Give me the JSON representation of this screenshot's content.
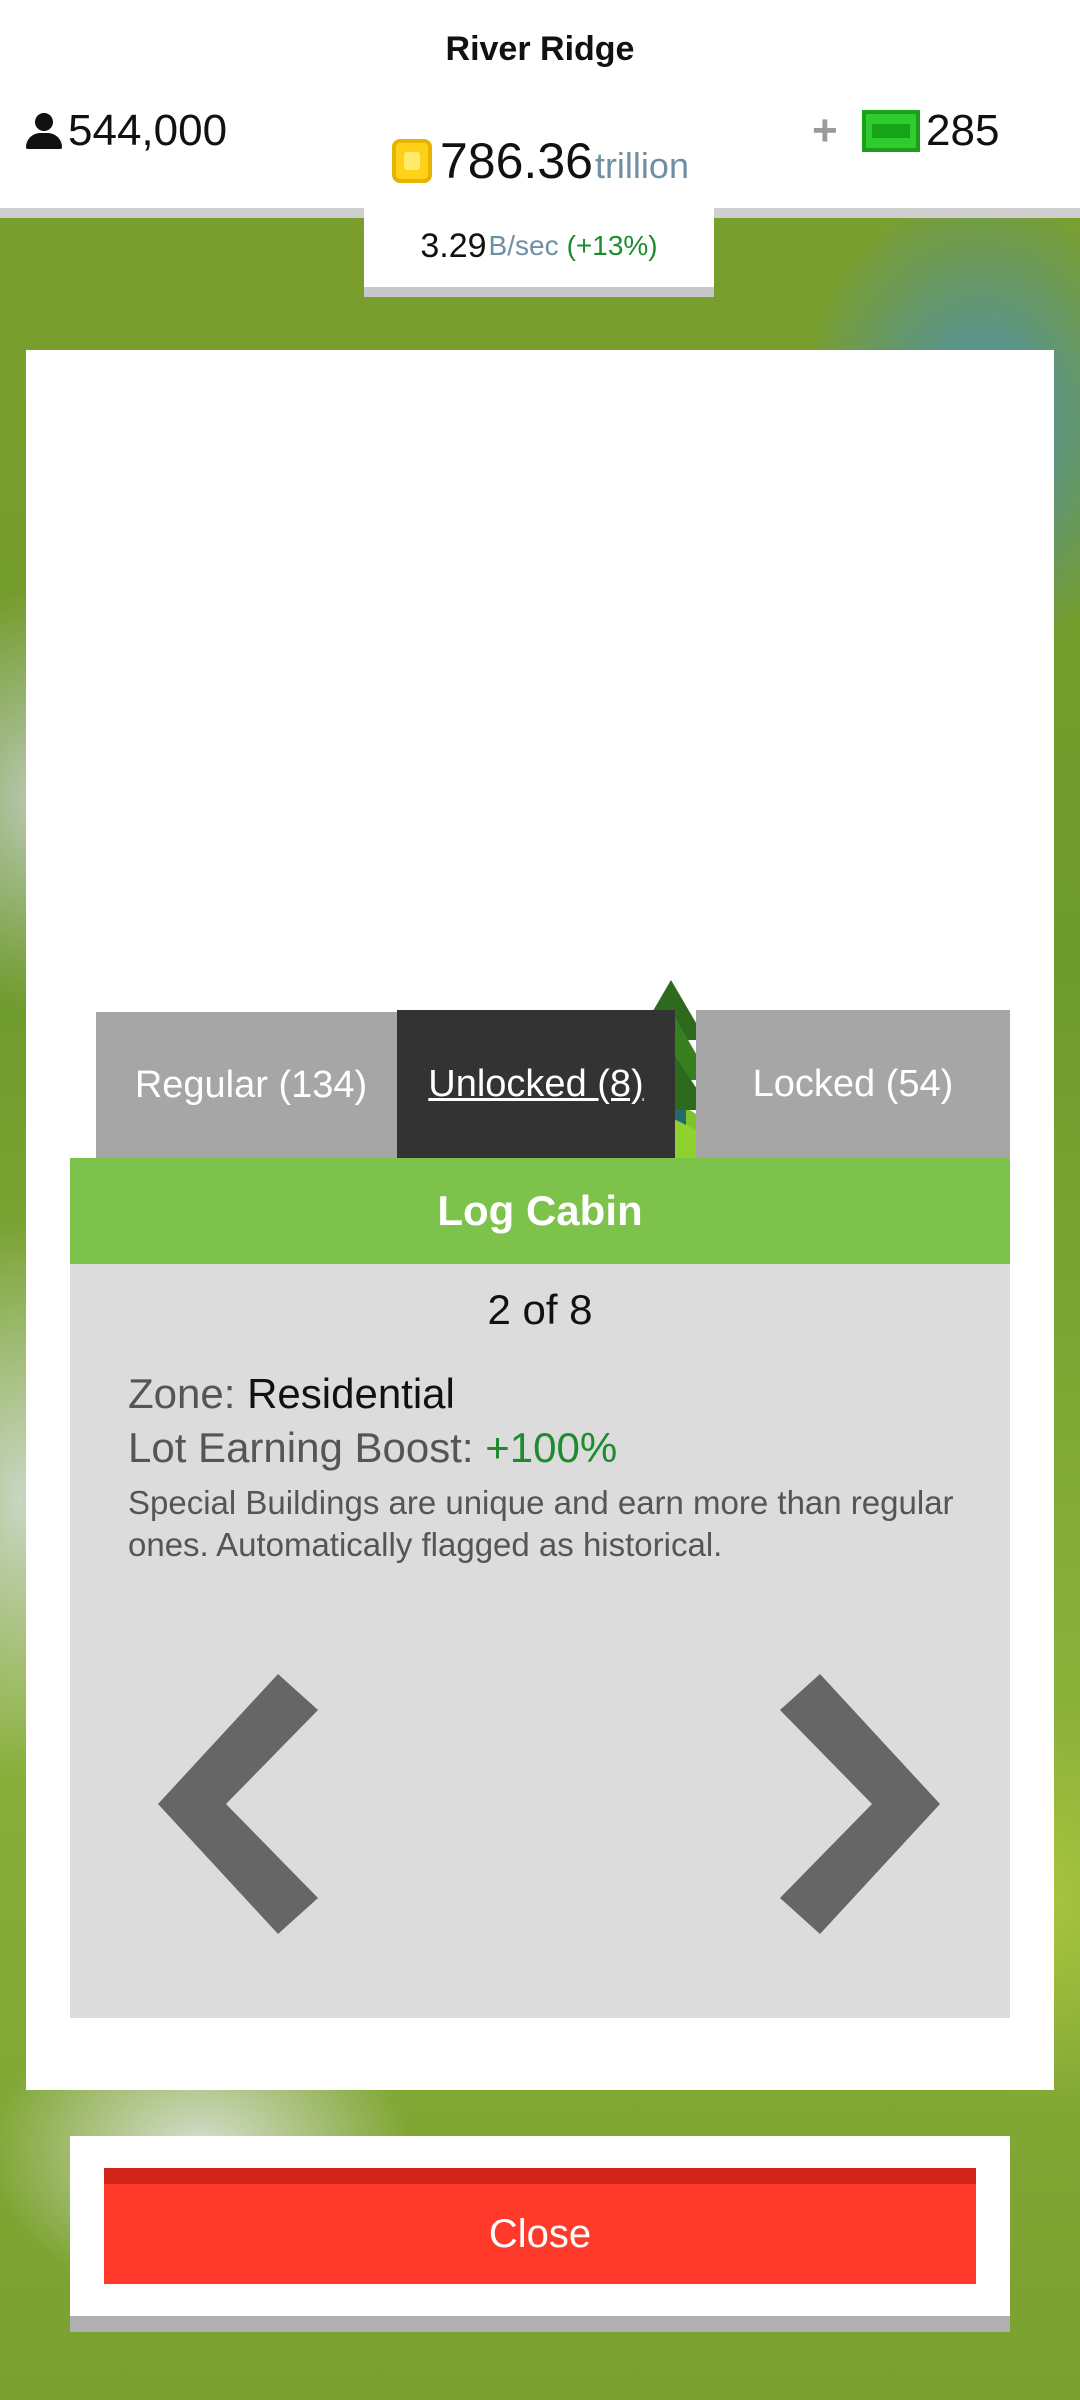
{
  "header": {
    "city_name": "River Ridge",
    "population": "544,000",
    "money_value": "786.36",
    "money_unit": "trillion",
    "plus": "+",
    "cash_value": "285",
    "rate_value": "3.29",
    "rate_unit": "B/sec",
    "rate_percent": "(+13%)"
  },
  "tabs": [
    {
      "label": "Regular (134)",
      "active": false
    },
    {
      "label": "Unlocked (8)",
      "active": true
    },
    {
      "label": "Locked (54)",
      "active": false
    }
  ],
  "building": {
    "name": "Log Cabin",
    "counter": "2 of 8",
    "zone_label": "Zone:",
    "zone_value": "Residential",
    "boost_label": "Lot Earning Boost:",
    "boost_value": "+100%",
    "description": "Special Buildings are unique and earn more than regular ones. Automatically flagged as historical."
  },
  "icons": {
    "population": "person-icon",
    "money": "coin-icon",
    "cash": "cash-icon",
    "prev": "chevron-left-icon",
    "next": "chevron-right-icon"
  },
  "colors": {
    "accent_green": "#7dc24b",
    "active_tab": "#333333",
    "inactive_tab": "#a6a6a6",
    "close_red": "#ff3a2a",
    "positive_green": "#1e8c2e"
  },
  "close_label": "Close"
}
